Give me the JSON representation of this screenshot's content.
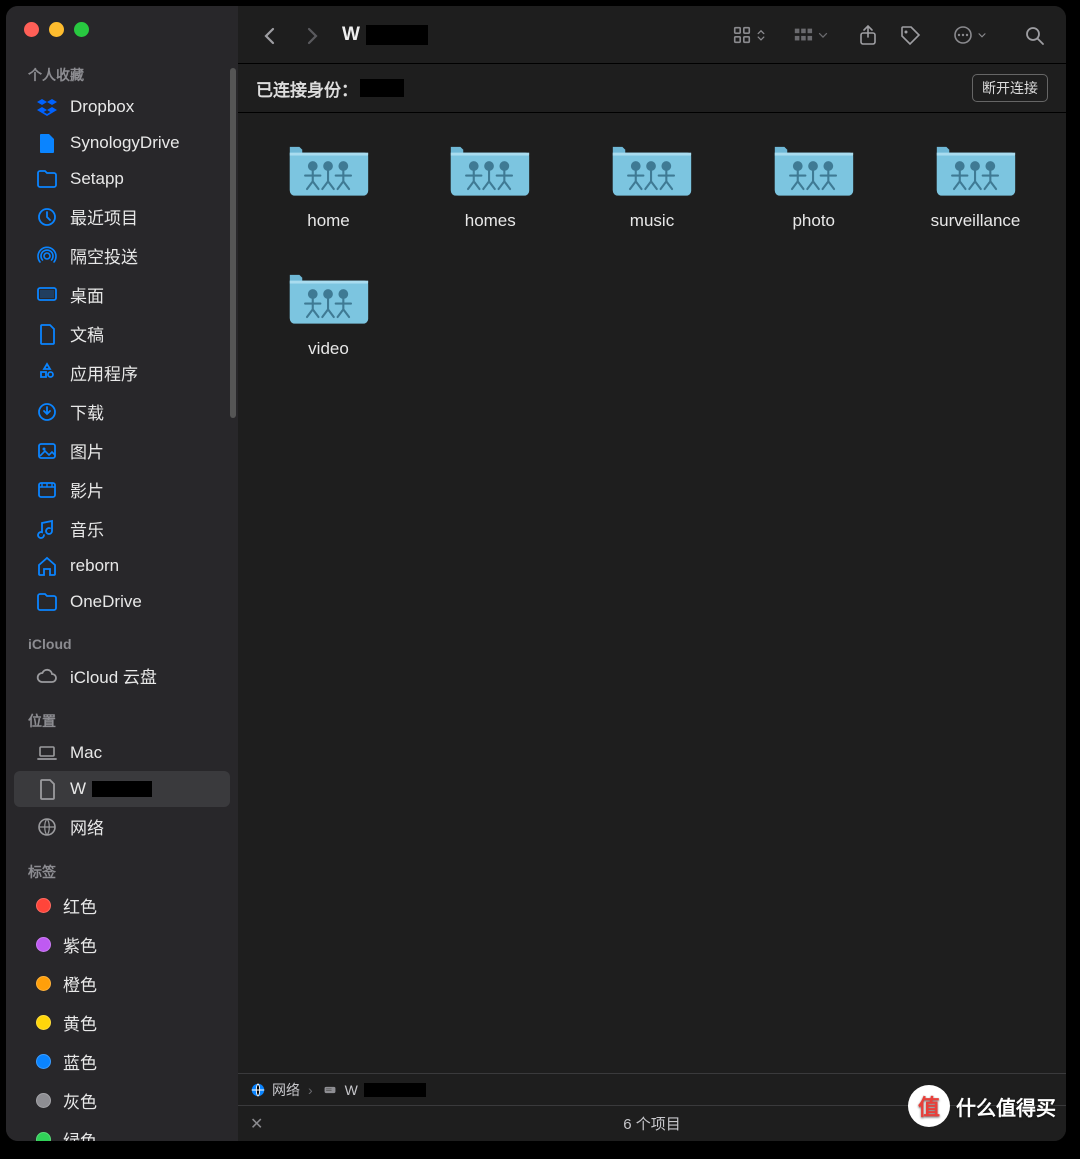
{
  "toolbar": {
    "title_visible": "W",
    "view_icon": "grid-view",
    "group_icon": "group-menu"
  },
  "connection": {
    "label": "已连接身份：",
    "disconnect": "断开连接"
  },
  "sidebar": {
    "favorites_heading": "个人收藏",
    "favorites": [
      {
        "label": "Dropbox",
        "icon": "dropbox",
        "color": "#0062ff"
      },
      {
        "label": "SynologyDrive",
        "icon": "file",
        "color": "#0a84ff"
      },
      {
        "label": "Setapp",
        "icon": "folder",
        "color": "#0a84ff"
      },
      {
        "label": "最近项目",
        "icon": "clock",
        "color": "#0a84ff"
      },
      {
        "label": "隔空投送",
        "icon": "airdrop",
        "color": "#0a84ff"
      },
      {
        "label": "桌面",
        "icon": "desktop",
        "color": "#0a84ff"
      },
      {
        "label": "文稿",
        "icon": "doc",
        "color": "#0a84ff"
      },
      {
        "label": "应用程序",
        "icon": "apps",
        "color": "#0a84ff"
      },
      {
        "label": "下载",
        "icon": "download",
        "color": "#0a84ff"
      },
      {
        "label": "图片",
        "icon": "picture",
        "color": "#0a84ff"
      },
      {
        "label": "影片",
        "icon": "movie",
        "color": "#0a84ff"
      },
      {
        "label": "音乐",
        "icon": "music",
        "color": "#0a84ff"
      },
      {
        "label": "reborn",
        "icon": "home",
        "color": "#0a84ff"
      },
      {
        "label": "OneDrive",
        "icon": "folder",
        "color": "#0a84ff"
      }
    ],
    "icloud_heading": "iCloud",
    "icloud": [
      {
        "label": "iCloud 云盘",
        "icon": "cloud",
        "color": "#9b9b9e"
      }
    ],
    "locations_heading": "位置",
    "locations": [
      {
        "label": "Mac",
        "icon": "laptop",
        "color": "#9b9b9e",
        "selected": false
      },
      {
        "label": "W",
        "icon": "doc",
        "color": "#9b9b9e",
        "selected": true,
        "redacted": true
      },
      {
        "label": "网络",
        "icon": "globe",
        "color": "#9b9b9e",
        "selected": false
      }
    ],
    "tags_heading": "标签",
    "tags": [
      {
        "label": "红色",
        "color": "#ff453a"
      },
      {
        "label": "紫色",
        "color": "#bf5af2"
      },
      {
        "label": "橙色",
        "color": "#ff9f0a"
      },
      {
        "label": "黄色",
        "color": "#ffd60a"
      },
      {
        "label": "蓝色",
        "color": "#0a84ff"
      },
      {
        "label": "灰色",
        "color": "#8e8e93"
      },
      {
        "label": "绿色",
        "color": "#30d158"
      }
    ]
  },
  "folders": [
    {
      "name": "home"
    },
    {
      "name": "homes"
    },
    {
      "name": "music"
    },
    {
      "name": "photo"
    },
    {
      "name": "surveillance"
    },
    {
      "name": "video"
    }
  ],
  "pathbar": {
    "seg1": "网络",
    "seg2_visible": "W"
  },
  "statusbar": {
    "text": "6 个项目"
  },
  "watermark": "什么值得买"
}
